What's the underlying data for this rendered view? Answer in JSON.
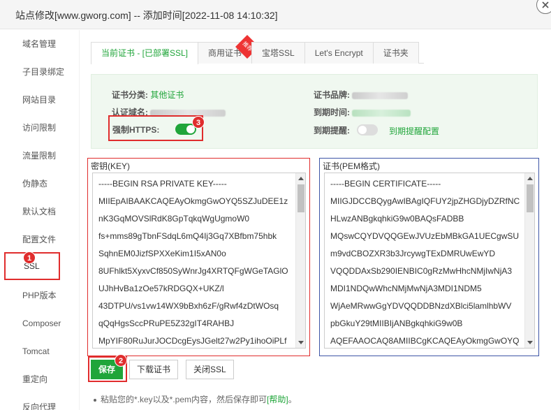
{
  "window": {
    "title": "站点修改[www.gworg.com] -- 添加时间[2022-11-08 14:10:32]"
  },
  "sidebar": {
    "items": [
      {
        "label": "域名管理"
      },
      {
        "label": "子目录绑定"
      },
      {
        "label": "网站目录"
      },
      {
        "label": "访问限制"
      },
      {
        "label": "流量限制"
      },
      {
        "label": "伪静态"
      },
      {
        "label": "默认文档"
      },
      {
        "label": "配置文件"
      },
      {
        "label": "SSL"
      },
      {
        "label": "PHP版本"
      },
      {
        "label": "Composer"
      },
      {
        "label": "Tomcat"
      },
      {
        "label": "重定向"
      },
      {
        "label": "反向代理"
      }
    ],
    "active_index": 8
  },
  "tabs": [
    {
      "label": "当前证书 - [已部署SSL]"
    },
    {
      "label": "商用证书",
      "ribbon": "推荐"
    },
    {
      "label": "宝塔SSL"
    },
    {
      "label": "Let's Encrypt"
    },
    {
      "label": "证书夹"
    }
  ],
  "cert_info": {
    "category_label": "证书分类:",
    "category_value": "其他证书",
    "domain_label": "认证域名:",
    "brand_label": "证书品牌:",
    "expire_label": "到期时间:",
    "remind_label": "到期提醒:",
    "remind_link": "到期提醒配置",
    "https_label": "强制HTTPS:",
    "https_enabled": true,
    "remind_enabled": false
  },
  "badges": {
    "ssl": "1",
    "save": "2",
    "https": "3"
  },
  "key_panel": {
    "title": "密钥(KEY)",
    "lines": [
      "-----BEGIN RSA PRIVATE KEY-----",
      "MIIEpAIBAAKCAQEAyOkmgGwOYQ5SZJuDEE1z",
      "nK3GqMOVSlRdK8GpTqkqWgUgmoW0",
      "fs+mms89gTbnFSdqL6mQ4Ij3Gq7XBfbm75hbk",
      "SqhnEM0JizfSPXXeKim1I5xAN0o",
      "8UFhlkt5XyxvCf850SyWnrJg4XRTQFgWGeTAGlO",
      "UJhHvBa1zOe57kRDGQX+UKZ/l",
      "43DTPU/vs1vw14WX9bBxh6zF/gRwf4zDtWOsq",
      "qQqHgsSccPRuPE5Z32gIT4RAHBJ",
      "MpYIF80RuJurJOCDcgEysJGelt27w2Py1ihoOiPLf"
    ]
  },
  "cert_panel": {
    "title": "证书(PEM格式)",
    "lines": [
      "-----BEGIN CERTIFICATE-----",
      "MIIGJDCCBQygAwIBAgIQFUY2jpZHGDjyDZRfNC",
      "HLwzANBgkqhkiG9w0BAQsFADBB",
      "MQswCQYDVQQGEwJVUzEbMBkGA1UECgwSU",
      "m9vdCBOZXR3b3JrcywgTExDMRUwEwYD",
      "VQQDDAxSb290IENBIC0gRzMwHhcNMjIwNjA3",
      "MDI1NDQwWhcNMjMwNjA3MDI1NDM5",
      "WjAeMRwwGgYDVQQDDBNzdXBlci5lamlhbWV",
      "pbGkuY29tMIIBIjANBgkqhkiG9w0B",
      "AQEFAAOCAQ8AMIIBCgKCAQEAyOkmgGwOYQ"
    ]
  },
  "buttons": {
    "save": "保存",
    "download": "下载证书",
    "close_ssl": "关闭SSL"
  },
  "tip": {
    "text": "粘贴您的*.key以及*.pem内容，然后保存即可",
    "help": "[帮助]",
    "end": "。"
  }
}
